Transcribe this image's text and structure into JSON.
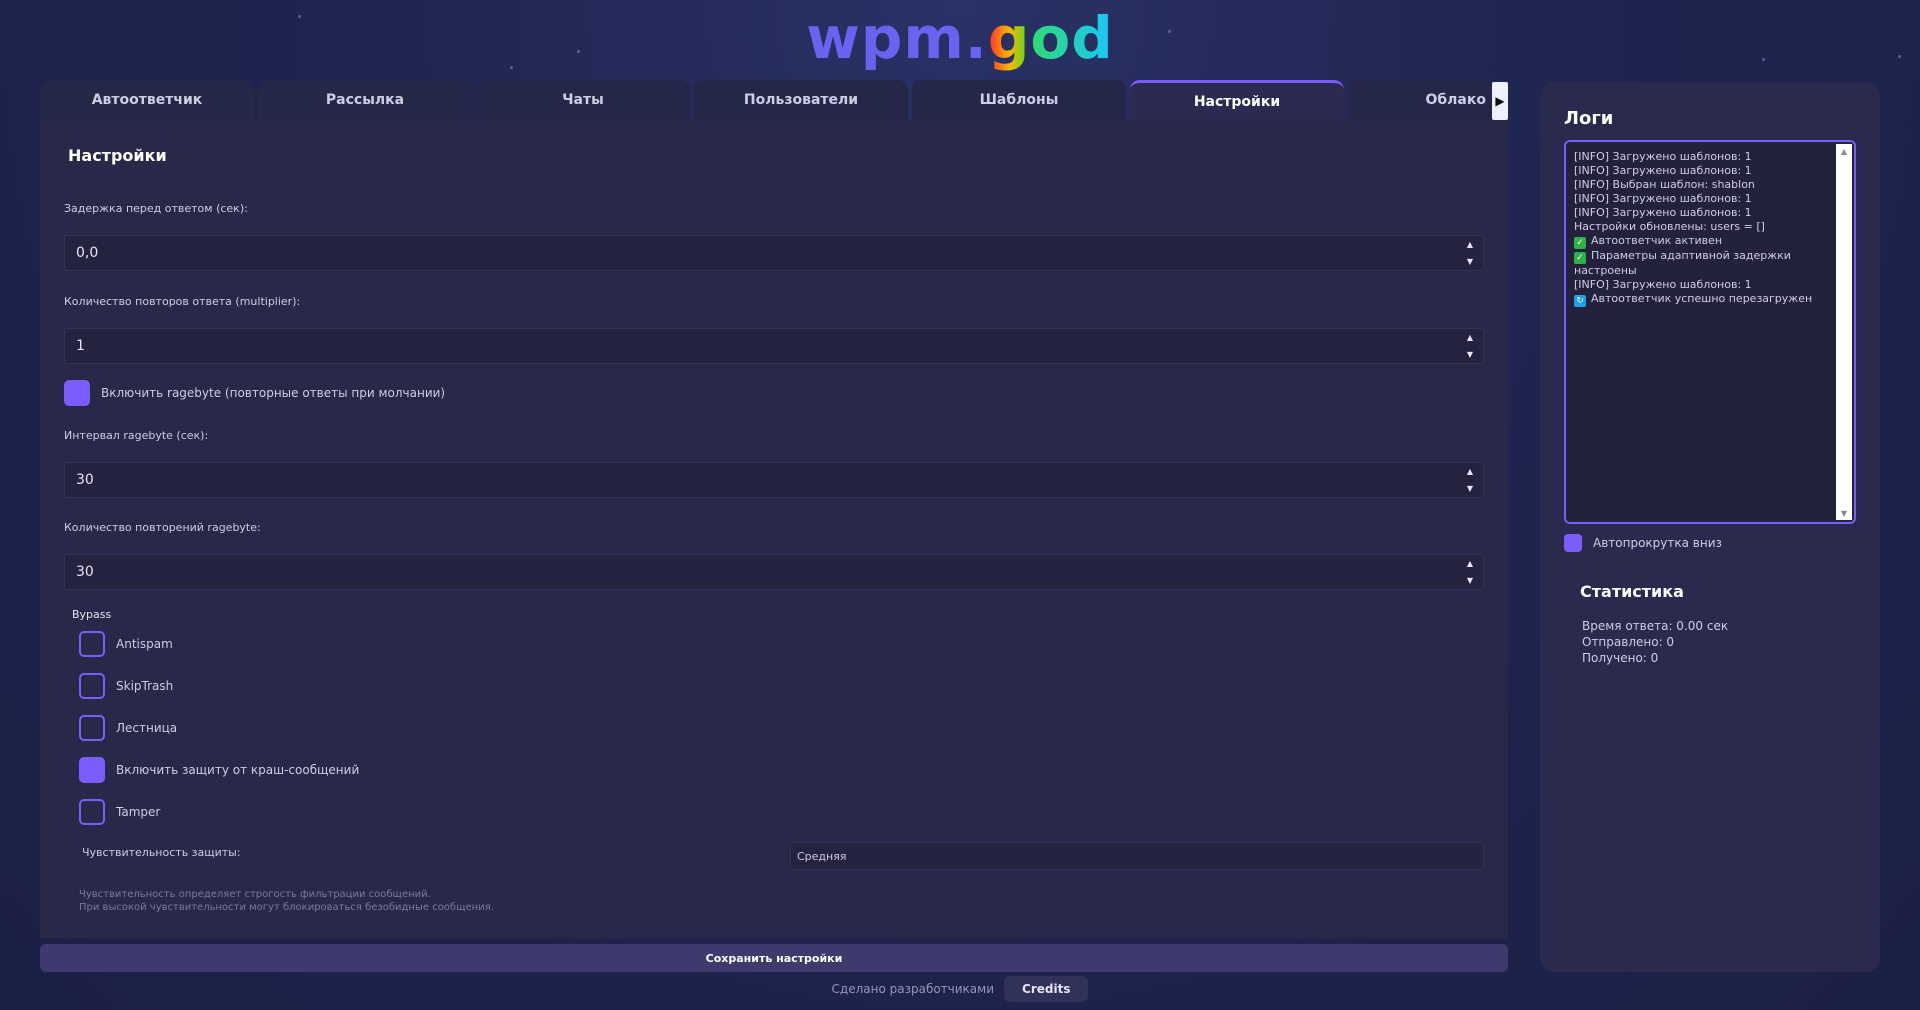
{
  "logo": {
    "part1": "wpm.",
    "part2": "g",
    "part3": "od"
  },
  "tabs": [
    {
      "label": "Автоответчик"
    },
    {
      "label": "Рассылка"
    },
    {
      "label": "Чаты"
    },
    {
      "label": "Пользователи"
    },
    {
      "label": "Шаблоны"
    },
    {
      "label": "Настройки",
      "active": true
    },
    {
      "label": "Облако"
    }
  ],
  "settings": {
    "title": "Настройки",
    "delay": {
      "label": "Задержка перед ответом (сек):",
      "value": "0,0"
    },
    "multiplier": {
      "label": "Количество повторов ответа (multiplier):",
      "value": "1"
    },
    "ragebyte_enable": {
      "label": "Включить ragebyte (повторные ответы при молчании)",
      "checked": true
    },
    "ragebyte_interval": {
      "label": "Интервал ragebyte (сек):",
      "value": "30"
    },
    "ragebyte_count": {
      "label": "Количество повторений ragebyte:",
      "value": "30"
    },
    "bypass": {
      "title": "Bypass",
      "items": [
        {
          "label": "Antispam",
          "checked": false
        },
        {
          "label": "SkipTrash",
          "checked": false
        },
        {
          "label": "Лестница",
          "checked": false
        },
        {
          "label": "Включить защиту от краш-сообщений",
          "checked": true
        },
        {
          "label": "Tamper",
          "checked": false
        }
      ]
    },
    "sensitivity": {
      "label": "Чувствительность защиты:",
      "value": "Средняя",
      "hint_line1": "Чувствительность определяет строгость фильтрации сообщений.",
      "hint_line2": "При высокой чувствительности могут блокироваться безобидные сообщения."
    },
    "save_label": "Сохранить настройки"
  },
  "footer": {
    "made_by": "Сделано разработчиками",
    "credits": "Credits"
  },
  "logs": {
    "title": "Логи",
    "lines": [
      {
        "text": "[INFO] Загружено шаблонов: 1"
      },
      {
        "text": "[INFO] Загружено шаблонов: 1"
      },
      {
        "text": "[INFO] Выбран шаблон: shablon"
      },
      {
        "text": "[INFO] Загружено шаблонов: 1"
      },
      {
        "text": "[INFO] Загружено шаблонов: 1"
      },
      {
        "text": "Настройки обновлены: users = []"
      },
      {
        "text": "Автоответчик активен",
        "icon": "check-icon"
      },
      {
        "text": "Параметры адаптивной задержки настроены",
        "icon": "check-icon"
      },
      {
        "text": "[INFO] Загружено шаблонов: 1"
      },
      {
        "text": "Автоответчик успешно перезагружен",
        "icon": "reload-icon"
      }
    ],
    "autoscroll": {
      "label": "Автопрокрутка вниз",
      "checked": true
    }
  },
  "stats": {
    "title": "Статистика",
    "response_time": "Время ответа: 0.00 сек",
    "sent": "Отправлено: 0",
    "received": "Получено: 0"
  },
  "colors": {
    "accent": "#7a5cff",
    "panel": "#282848",
    "background": "#1f2550"
  }
}
